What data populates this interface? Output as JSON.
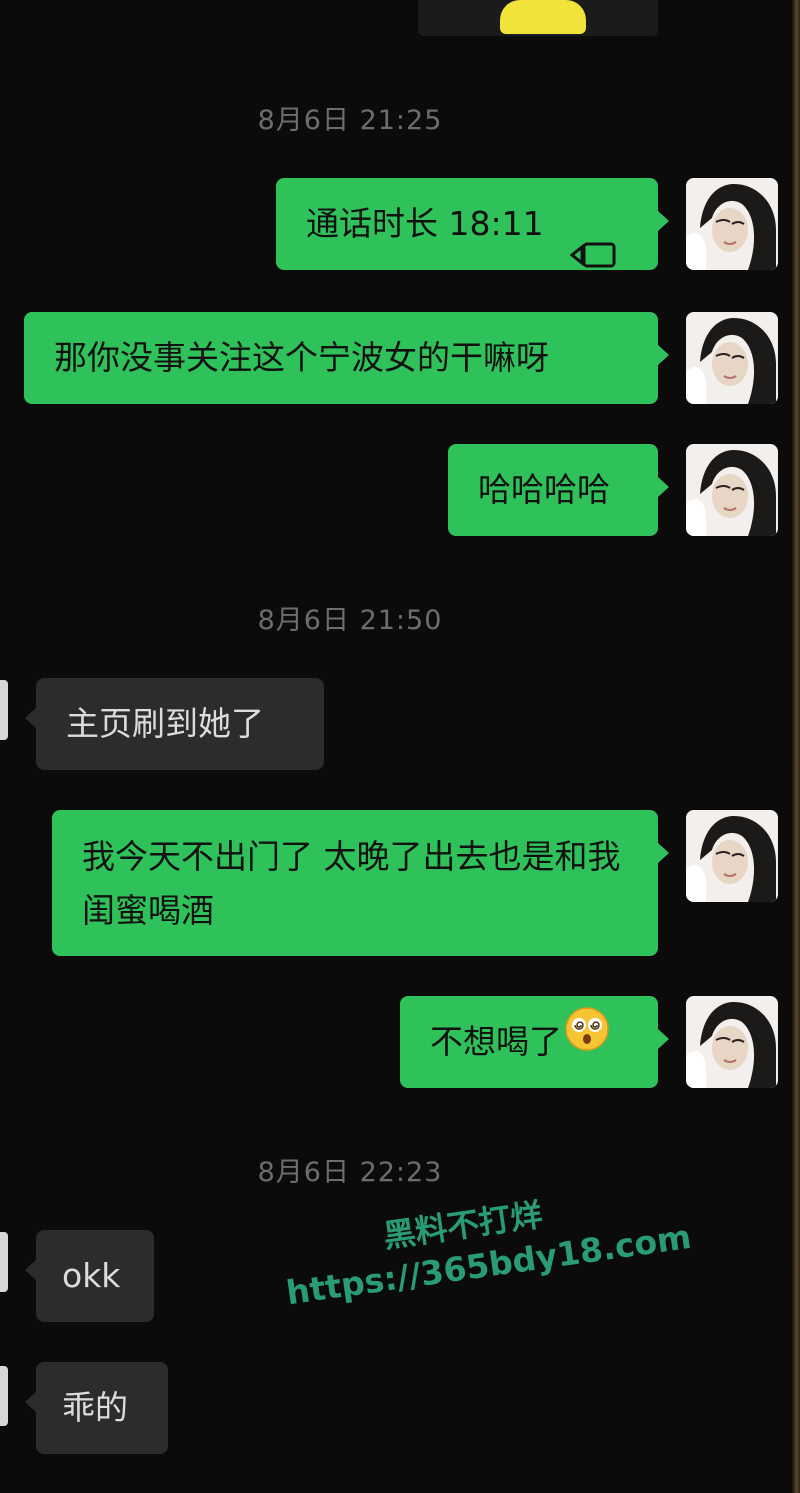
{
  "chat": {
    "timestamps": [
      "8月6日 21:25",
      "8月6日 21:50",
      "8月6日 22:23"
    ],
    "messages": [
      {
        "side": "right",
        "text": "通话时长 18:11",
        "icon": "video-call-icon"
      },
      {
        "side": "right",
        "text": "那你没事关注这个宁波女的干嘛呀"
      },
      {
        "side": "right",
        "text": "哈哈哈哈"
      },
      {
        "side": "left",
        "text": "主页刷到她了"
      },
      {
        "side": "right",
        "text": "我今天不出门了 太晚了出去也是和我闺蜜喝酒"
      },
      {
        "side": "right",
        "text": "不想喝了",
        "icon": "dizzy-face-emoji"
      },
      {
        "side": "left",
        "text": "okk"
      },
      {
        "side": "left",
        "text": "乖的"
      }
    ]
  },
  "watermark": {
    "title": "黑料不打烊",
    "url": "https://365bdy18.com"
  },
  "colors": {
    "background": "#0b0b0b",
    "outgoing_bubble": "#2fc25b",
    "incoming_bubble": "#2c2c2c",
    "timestamp": "#6d6d6d",
    "watermark": "#2a9c74"
  }
}
